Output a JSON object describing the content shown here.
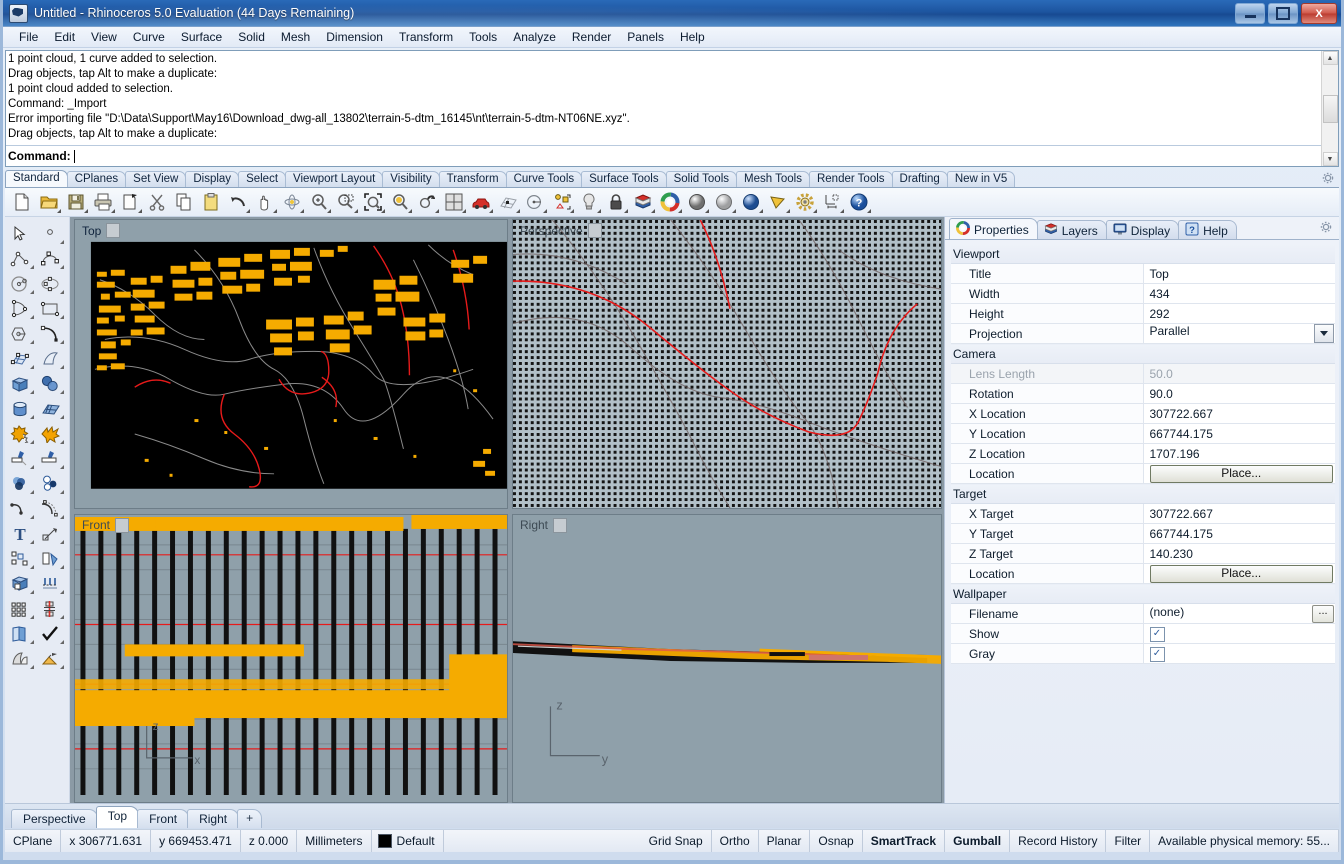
{
  "window": {
    "title": "Untitled - Rhinoceros 5.0 Evaluation (44 Days Remaining)",
    "minimize_label": "Minimize",
    "maximize_label": "Maximize",
    "close_label": "X"
  },
  "menubar": [
    {
      "label": "File"
    },
    {
      "label": "Edit"
    },
    {
      "label": "View"
    },
    {
      "label": "Curve"
    },
    {
      "label": "Surface"
    },
    {
      "label": "Solid"
    },
    {
      "label": "Mesh"
    },
    {
      "label": "Dimension"
    },
    {
      "label": "Transform"
    },
    {
      "label": "Tools"
    },
    {
      "label": "Analyze"
    },
    {
      "label": "Render"
    },
    {
      "label": "Panels"
    },
    {
      "label": "Help"
    }
  ],
  "command_history": [
    "1 point cloud, 1 curve added to selection.",
    "Drag objects, tap Alt to make a duplicate:",
    "1 point cloud added to selection.",
    "Command: _Import",
    "Error importing file \"D:\\Data\\Support\\May16\\Download_dwg-all_13802\\terrain-5-dtm_16145\\nt\\terrain-5-dtm-NT06NE.xyz\".",
    "Drag objects, tap Alt to make a duplicate:"
  ],
  "command_prompt": {
    "label": "Command:",
    "value": ""
  },
  "toolbar_tabs": [
    {
      "label": "Standard",
      "active": true
    },
    {
      "label": "CPlanes",
      "active": false
    },
    {
      "label": "Set View",
      "active": false
    },
    {
      "label": "Display",
      "active": false
    },
    {
      "label": "Select",
      "active": false
    },
    {
      "label": "Viewport Layout",
      "active": false
    },
    {
      "label": "Visibility",
      "active": false
    },
    {
      "label": "Transform",
      "active": false
    },
    {
      "label": "Curve Tools",
      "active": false
    },
    {
      "label": "Surface Tools",
      "active": false
    },
    {
      "label": "Solid Tools",
      "active": false
    },
    {
      "label": "Mesh Tools",
      "active": false
    },
    {
      "label": "Render Tools",
      "active": false
    },
    {
      "label": "Drafting",
      "active": false
    },
    {
      "label": "New in V5",
      "active": false
    }
  ],
  "toolbar_icons": [
    "new-file-icon",
    "open-folder-icon",
    "save-icon",
    "print-icon",
    "copy-to-clipboard-icon",
    "cut-scissors-icon",
    "copy-icon",
    "paste-icon",
    "undo-icon",
    "pan-hand-icon",
    "rotate-view-icon",
    "zoom-in-icon",
    "zoom-window-icon",
    "zoom-extents-icon",
    "zoom-selected-icon",
    "undo-view-icon",
    "viewport-layout-icon",
    "car-render-icon",
    "grid-snap-icon",
    "circle-center-icon",
    "object-snap-icon",
    "light-bulb-icon",
    "lock-icon",
    "layers-icon",
    "color-wheel-icon",
    "shaded-sphere-icon",
    "ghosted-sphere-icon",
    "rendered-sphere-icon",
    "camera-cone-icon",
    "options-gear-icon",
    "dimension-icon",
    "help-icon"
  ],
  "sidebar_icons": [
    "select-arrow-icon",
    "point-icon",
    "polyline-icon",
    "control-point-curve-icon",
    "circle-icon",
    "ellipse-icon",
    "polygon-triangle-icon",
    "rectangle-icon",
    "hexagon-icon",
    "arc-icon",
    "surface-from-points-icon",
    "extrude-surface-icon",
    "box-icon",
    "sphere-boolean-icon",
    "cylinder-icon",
    "mesh-plane-icon",
    "boolean-union-icon",
    "explode-icon",
    "trim-icon",
    "split-icon",
    "blend-icon",
    "fillet-icon",
    "fillet-curve-icon",
    "offset-curve-icon",
    "text-icon",
    "leader-dimension-icon",
    "array-icon",
    "rotate-icon",
    "cap-solid-icon",
    "extrude-srf-icon",
    "grid-array-icon",
    "analyze-direction-icon",
    "layout-page-icon",
    "check-objects-icon",
    "unroll-surface-icon",
    "render-icon"
  ],
  "viewports": {
    "top": {
      "title": "Top",
      "active": true
    },
    "perspective": {
      "title": "Perspective",
      "active": false
    },
    "front": {
      "title": "Front",
      "active": false
    },
    "right": {
      "title": "Right",
      "active": false
    }
  },
  "axis_gizmos": {
    "front": {
      "v": "z",
      "h": "x"
    },
    "right": {
      "v": "z",
      "h": "y"
    }
  },
  "viewport_tabs": [
    {
      "label": "Perspective",
      "active": false
    },
    {
      "label": "Top",
      "active": true
    },
    {
      "label": "Front",
      "active": false
    },
    {
      "label": "Right",
      "active": false
    },
    {
      "label": "+",
      "active": false
    }
  ],
  "right_panel": {
    "tabs": [
      {
        "label": "Properties",
        "icon": "properties-color-wheel-icon",
        "active": true
      },
      {
        "label": "Layers",
        "icon": "layers-icon",
        "active": false
      },
      {
        "label": "Display",
        "icon": "display-monitor-icon",
        "active": false
      },
      {
        "label": "Help",
        "icon": "help-icon",
        "active": false
      }
    ],
    "gear_icon": "panel-options-gear-icon",
    "groups": [
      {
        "name": "Viewport",
        "rows": [
          {
            "label": "Title",
            "value": "Top",
            "type": "text"
          },
          {
            "label": "Width",
            "value": "434",
            "type": "text"
          },
          {
            "label": "Height",
            "value": "292",
            "type": "text"
          },
          {
            "label": "Projection",
            "value": "Parallel",
            "type": "dropdown"
          }
        ]
      },
      {
        "name": "Camera",
        "rows": [
          {
            "label": "Lens Length",
            "value": "50.0",
            "type": "text",
            "disabled": true
          },
          {
            "label": "Rotation",
            "value": "90.0",
            "type": "text"
          },
          {
            "label": "X Location",
            "value": "307722.667",
            "type": "text"
          },
          {
            "label": "Y Location",
            "value": "667744.175",
            "type": "text"
          },
          {
            "label": "Z Location",
            "value": "1707.196",
            "type": "text"
          },
          {
            "label": "Location",
            "value": "Place...",
            "type": "button"
          }
        ]
      },
      {
        "name": "Target",
        "rows": [
          {
            "label": "X Target",
            "value": "307722.667",
            "type": "text"
          },
          {
            "label": "Y Target",
            "value": "667744.175",
            "type": "text"
          },
          {
            "label": "Z Target",
            "value": "140.230",
            "type": "text"
          },
          {
            "label": "Location",
            "value": "Place...",
            "type": "button"
          }
        ]
      },
      {
        "name": "Wallpaper",
        "rows": [
          {
            "label": "Filename",
            "value": "(none)",
            "type": "file"
          },
          {
            "label": "Show",
            "value": "✓",
            "type": "checkbox"
          },
          {
            "label": "Gray",
            "value": "✓",
            "type": "checkbox"
          }
        ]
      }
    ]
  },
  "statusbar": {
    "cplane": "CPlane",
    "x": "x 306771.631",
    "y": "y 669453.471",
    "z": "z 0.000",
    "units": "Millimeters",
    "layer": "Default",
    "layer_color": "#000000",
    "toggles": [
      {
        "label": "Grid Snap",
        "on": false
      },
      {
        "label": "Ortho",
        "on": false
      },
      {
        "label": "Planar",
        "on": false
      },
      {
        "label": "Osnap",
        "on": false
      },
      {
        "label": "SmartTrack",
        "on": true
      },
      {
        "label": "Gumball",
        "on": true
      },
      {
        "label": "Record History",
        "on": false
      },
      {
        "label": "Filter",
        "on": false
      }
    ],
    "memory": "Available physical memory: 55..."
  },
  "colors": {
    "accent_blue": "#1d55a0",
    "viewport_bg": "#8fa0aa",
    "top_viewport_bg": "#000000",
    "object_yellow": "#f5ab00",
    "object_red": "#e61a1a",
    "object_gray": "#8a8a8a"
  }
}
